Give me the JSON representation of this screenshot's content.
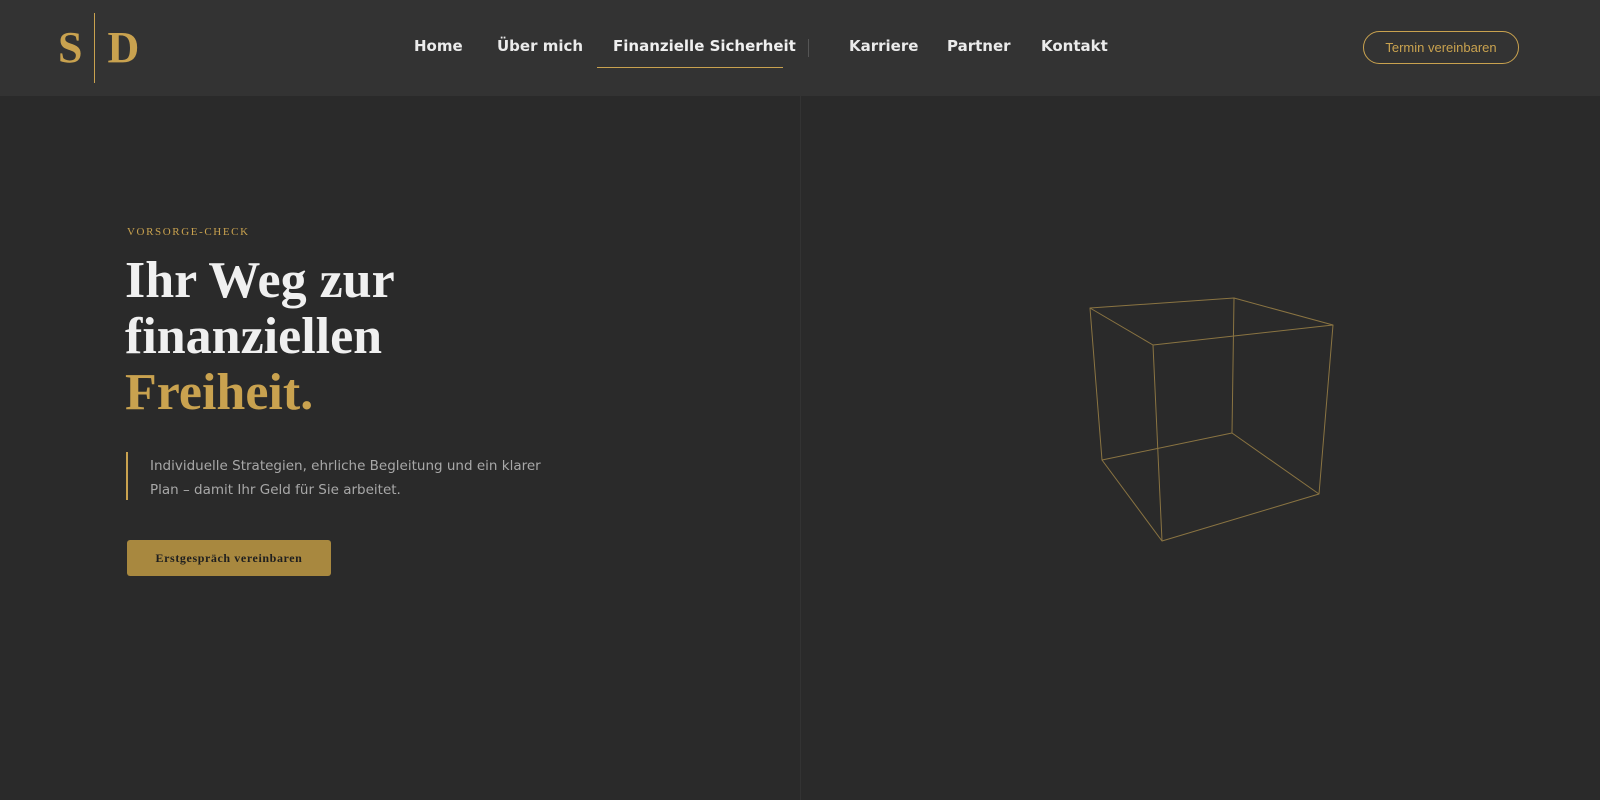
{
  "header": {
    "logo": {
      "left": "S",
      "right": "D"
    },
    "nav": [
      {
        "label": "Home"
      },
      {
        "label": "Über mich"
      },
      {
        "label": "Finanzielle Sicherheit",
        "active": true
      },
      {
        "label": "Karriere"
      },
      {
        "label": "Partner"
      },
      {
        "label": "Kontakt"
      }
    ],
    "cta_label": "Termin vereinbaren"
  },
  "hero": {
    "eyebrow": "VORSORGE-CHECK",
    "headline": {
      "line1": "Ihr Weg zur",
      "line2": "finanziellen",
      "line3_accent": "Freiheit."
    },
    "lead": "Individuelle Strategien, ehrliche Begleitung und ein klarer Plan – damit Ihr Geld für Sie arbeitet.",
    "cta_label": "Erstgespräch vereinbaren"
  },
  "visual": {
    "icon": "wireframe-cube-icon"
  },
  "colors": {
    "background": "#2a2a2a",
    "header_background": "#333333",
    "accent_gold": "#c9a24f",
    "button_gold": "#a8883f",
    "text_primary": "#f0f0f0",
    "text_muted": "#a8a8a8"
  }
}
